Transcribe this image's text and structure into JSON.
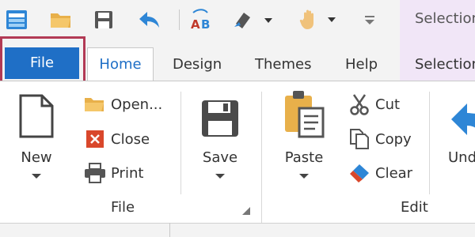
{
  "context_tab": {
    "title": "Selection"
  },
  "tabs": [
    "File",
    "Home",
    "Design",
    "Themes",
    "Help",
    "Selection"
  ],
  "groups": {
    "file": "File",
    "edit": "Edit"
  },
  "buttons": {
    "new": "New",
    "open": "Open...",
    "close": "Close",
    "print": "Print",
    "save": "Save",
    "paste": "Paste",
    "cut": "Cut",
    "copy": "Copy",
    "clear": "Clear",
    "undo": "Und"
  },
  "colors": {
    "accent": "#1f6fc6",
    "highlight": "#b23a55",
    "context": "#f1e6f7"
  }
}
